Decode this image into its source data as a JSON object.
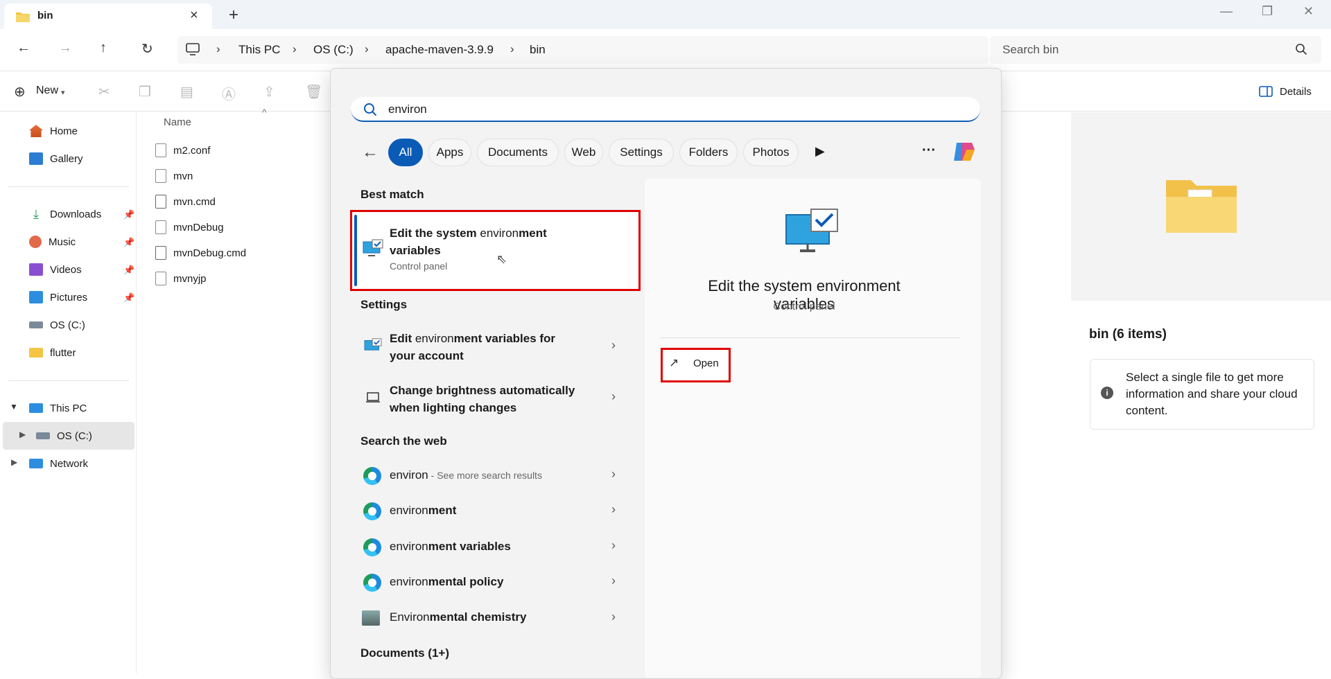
{
  "window": {
    "tab_title": "bin",
    "minimize": "—",
    "restore": "❐",
    "close": "✕"
  },
  "breadcrumb": [
    "This PC",
    "OS (C:)",
    "apache-maven-3.9.9",
    "bin"
  ],
  "search_bin_placeholder": "Search bin",
  "toolbar": {
    "new_label": "New",
    "details_label": "Details"
  },
  "nav": {
    "items": [
      {
        "label": "Home"
      },
      {
        "label": "Gallery"
      },
      {
        "label": "Downloads"
      },
      {
        "label": "Music"
      },
      {
        "label": "Videos"
      },
      {
        "label": "Pictures"
      },
      {
        "label": "OS (C:)"
      },
      {
        "label": "flutter"
      },
      {
        "label": "This PC"
      },
      {
        "label": "OS (C:)"
      },
      {
        "label": "Network"
      }
    ]
  },
  "files": {
    "column_name": "Name",
    "items": [
      "m2.conf",
      "mvn",
      "mvn.cmd",
      "mvnDebug",
      "mvnDebug.cmd",
      "mvnyjp"
    ]
  },
  "details": {
    "title": "bin (6 items)",
    "info": "Select a single file to get more information and share your cloud content."
  },
  "start_search": {
    "query": "environ",
    "filters": [
      "All",
      "Apps",
      "Documents",
      "Web",
      "Settings",
      "Folders",
      "Photos"
    ],
    "more": "···",
    "best_match_header": "Best match",
    "best_match": {
      "title_plain": "Edit the system ",
      "title_match": "environ",
      "title_rest": "ment",
      "title_line2": "variables",
      "subtitle": "Control panel"
    },
    "settings_header": "Settings",
    "settings": [
      {
        "pre": "Edit ",
        "match": "environ",
        "rest": "ment variables for",
        "line2": "your account"
      },
      {
        "pre": "",
        "match": "",
        "rest": "Change brightness automatically",
        "line2": "when lighting changes"
      }
    ],
    "web_header": "Search the web",
    "web": [
      {
        "match": "environ",
        "rest": "",
        "suffix": " - See more search results"
      },
      {
        "match": "environ",
        "rest": "ment",
        "suffix": ""
      },
      {
        "match": "environ",
        "rest": "ment variables",
        "suffix": ""
      },
      {
        "match": "environ",
        "rest": "mental policy",
        "suffix": ""
      },
      {
        "match": "Environ",
        "rest": "mental chemistry",
        "suffix": ""
      }
    ],
    "documents_header": "Documents (1+)",
    "preview": {
      "title": "Edit the system environment variables",
      "subtitle": "Control panel",
      "open_label": "Open"
    }
  },
  "colors": {
    "accent": "#0a5bb5",
    "highlight": "#e00000"
  }
}
